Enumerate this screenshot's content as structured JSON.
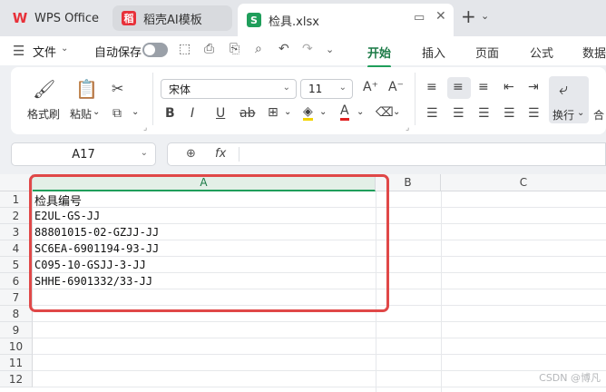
{
  "tabs": {
    "wps_label": "WPS Office",
    "template_label": "稻壳AI模板",
    "file_label": "检具.xlsx",
    "file_icon_letter": "S"
  },
  "menu": {
    "file": "文件",
    "autosave": "自动保存",
    "ribbon_tabs": [
      "开始",
      "插入",
      "页面",
      "公式",
      "数据"
    ]
  },
  "ribbon": {
    "format_painter": "格式刷",
    "paste": "粘贴",
    "font_name": "宋体",
    "font_size": "11",
    "wrap_text": "换行",
    "merge": "合"
  },
  "formula_bar": {
    "cell_ref": "A17",
    "fx": "fx"
  },
  "grid": {
    "columns": [
      "A",
      "B",
      "C"
    ],
    "row_numbers": [
      "1",
      "2",
      "3",
      "4",
      "5",
      "6",
      "7",
      "8",
      "9",
      "10",
      "11",
      "12"
    ],
    "cells": [
      "检具编号",
      "E2UL-GS-JJ",
      "88801015-02-GZJJ-JJ",
      "SC6EA-6901194-93-JJ",
      "C095-10-GSJJ-3-JJ",
      "SHHE-6901332/33-JJ"
    ]
  },
  "watermark": "CSDN @博凡",
  "colors": {
    "accent": "#1f9e5b",
    "highlight_box": "#e04848"
  }
}
